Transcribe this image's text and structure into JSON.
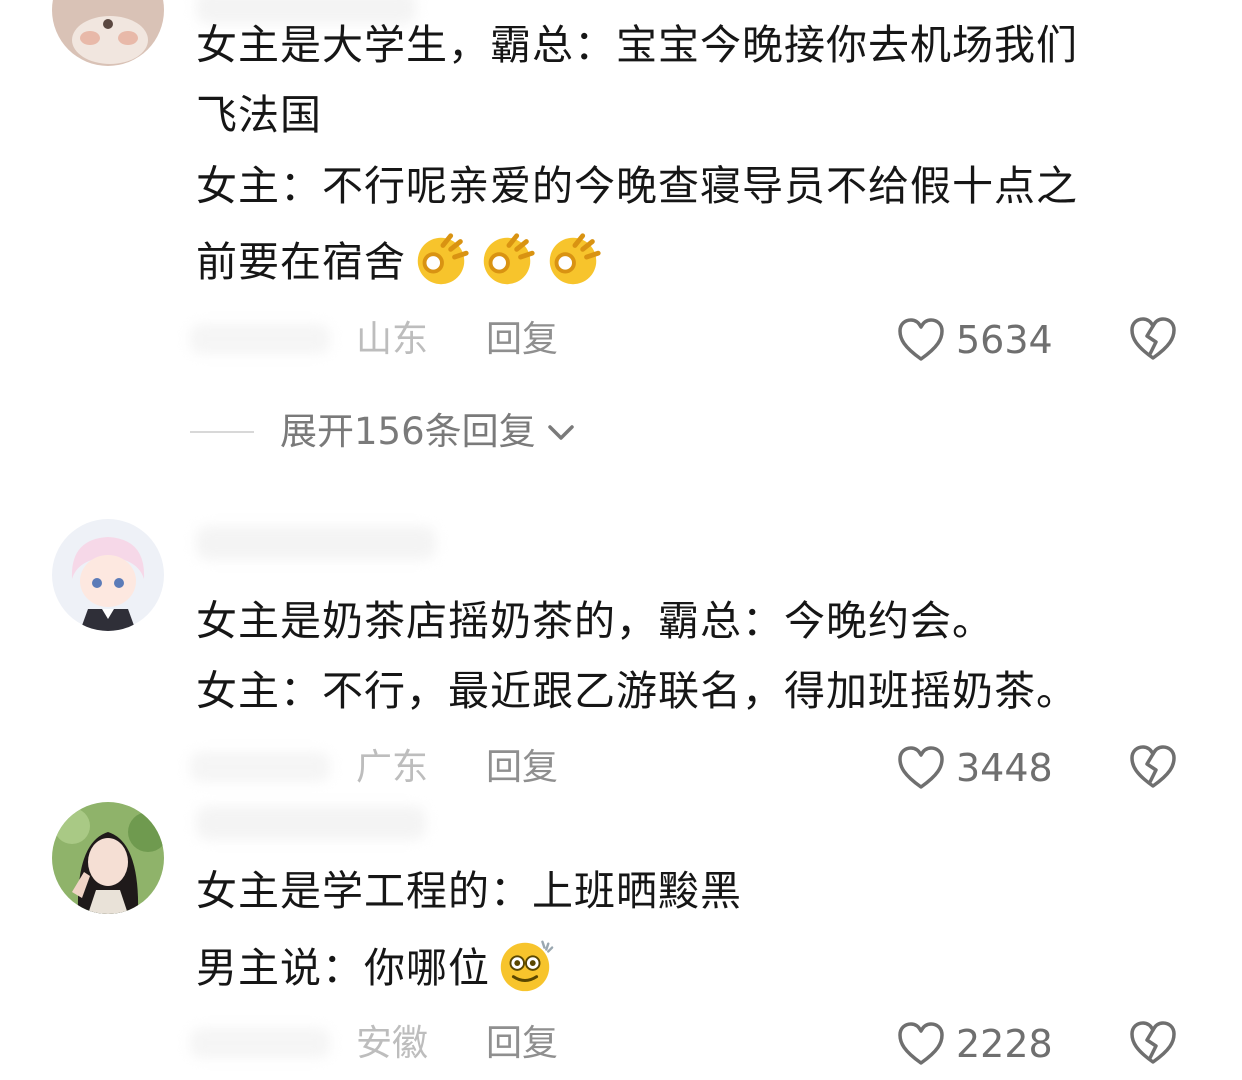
{
  "comments": [
    {
      "lines": [
        "女主是大学生，霸总：宝宝今晚接你去机场我们",
        "飞法国",
        "女主：不行呢亲爱的今晚查寝导员不给假十点之",
        "前要在宿舍"
      ],
      "emoji": "ok-hand-icon",
      "location": "山东",
      "reply_label": "回复",
      "likes": "5634"
    },
    {
      "lines": [
        "女主是奶茶店摇奶茶的，霸总：今晚约会。",
        "女主：不行，最近跟乙游联名，得加班摇奶茶。"
      ],
      "location": "广东",
      "reply_label": "回复",
      "likes": "3448"
    },
    {
      "lines": [
        "女主是学工程的：上班晒黢黑",
        "男主说：你哪位"
      ],
      "emoji": "grinning-sweat-icon",
      "location": "安徽",
      "reply_label": "回复",
      "likes": "2228"
    }
  ],
  "expand_replies": "展开156条回复",
  "colors": {
    "text": "#161616",
    "meta": "#bdbdbd",
    "reply": "#8f8f8f",
    "count": "#6f6f6f",
    "emoji_yellow": "#f7c42c"
  }
}
